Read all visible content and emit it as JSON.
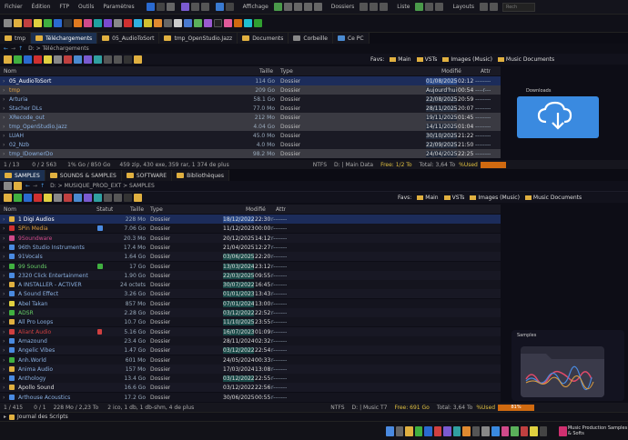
{
  "menubar": {
    "items": [
      "Fichier",
      "Édition",
      "FTP",
      "Outils",
      "Paramètres"
    ],
    "affichage": "Affichage",
    "dossiers": "Dossiers",
    "liste": "Liste",
    "layouts": "Layouts",
    "search_placeholder": "Rech"
  },
  "top_tabs": [
    "tmp",
    "Téléchargements",
    "05_AudioToSort",
    "tmp_OpenStudio.Jazz",
    "Documents",
    "Corbeille",
    "Ce PC"
  ],
  "top_address": "D: > Téléchargements",
  "top_favs": {
    "label": "Favs:",
    "items": [
      "Main",
      "VSTs",
      "Images (Music)",
      "Music Documents"
    ]
  },
  "top_headers": {
    "name": "Nom",
    "size": "Taille",
    "type": "Type",
    "modified": "Modifié",
    "attr": "Attr"
  },
  "top_rows": [
    {
      "name": "05_AudioToSort",
      "size": "114 Go",
      "type": "Dossier",
      "date": "01/08/2025",
      "time": "02:12",
      "attr": "--------"
    },
    {
      "name": "tmp",
      "size": "209 Go",
      "type": "Dossier",
      "date": "Aujourd'hui",
      "time": "00:54",
      "attr": "----r---"
    },
    {
      "name": "Arturia",
      "size": "58.1 Go",
      "type": "Dossier",
      "date": "22/08/2025",
      "time": "20:59",
      "attr": "--------"
    },
    {
      "name": "Stacher DLs",
      "size": "77.0 Mo",
      "type": "Dossier",
      "date": "28/11/2025",
      "time": "20:07",
      "attr": "--------"
    },
    {
      "name": "XRecode_out",
      "size": "212 Mo",
      "type": "Dossier",
      "date": "19/11/2025",
      "time": "01:45",
      "attr": "--------"
    },
    {
      "name": "tmp_OpenStudio.Jazz",
      "size": "4.04 Go",
      "type": "Dossier",
      "date": "14/11/2025",
      "time": "01:04",
      "attr": "--------"
    },
    {
      "name": "LUAH",
      "size": "45.0 Mo",
      "type": "Dossier",
      "date": "30/10/2025",
      "time": "21:22",
      "attr": "--------"
    },
    {
      "name": "02_Nzb",
      "size": "4.0 Mo",
      "type": "Dossier",
      "date": "22/09/2025",
      "time": "21:50",
      "attr": "--------"
    },
    {
      "name": "tmp_IDownerDo",
      "size": "98.2 Mo",
      "type": "Dossier",
      "date": "24/04/2025",
      "time": "22:25",
      "attr": "--------"
    }
  ],
  "top_preview_label": "Downloads",
  "top_status": {
    "count": "1 / 13",
    "sel": "0 / 2 563",
    "size": "1% Go / 850 Go",
    "info": "459 zip, 430 exe, 359 rar, 1 374 de plus",
    "drive": "NTFS",
    "path": "D: | Main Data",
    "free": "Free: 1/2 To",
    "total": "Total: 3,64 To",
    "used": "%Used"
  },
  "bottom_tabs": [
    "SAMPLES",
    "SOUNDS & SAMPLES",
    "SOFTWARE",
    "Bibliothèques"
  ],
  "bottom_address": "D: > MUSIQUE_PROD_EXT > SAMPLES",
  "bottom_favs": {
    "label": "Favs:",
    "items": [
      "Main",
      "VSTs",
      "Images (Music)",
      "Music Documents"
    ]
  },
  "bottom_headers": {
    "name": "Nom",
    "status": "Statut",
    "size": "Taille",
    "type": "Type",
    "modified": "Modifié",
    "attr": "Attr"
  },
  "bottom_rows": [
    {
      "name": "1 Digi Audios",
      "size": "228 Mo",
      "type": "Dossier",
      "date": "18/12/2022",
      "time": "22:30",
      "attr": "r-------"
    },
    {
      "name": "SPin Media",
      "size": "7.06 Go",
      "type": "Dossier",
      "date": "11/12/2023",
      "time": "00:00",
      "attr": "r-------"
    },
    {
      "name": "9Soundware",
      "size": "20.3 Mo",
      "type": "Dossier",
      "date": "20/12/2025",
      "time": "14:12",
      "attr": "r-------"
    },
    {
      "name": "96th Studio Instruments",
      "size": "17.4 Mo",
      "type": "Dossier",
      "date": "21/04/2025",
      "time": "12:27",
      "attr": "r-------"
    },
    {
      "name": "91Vocals",
      "size": "1.64 Go",
      "type": "Dossier",
      "date": "03/06/2025",
      "time": "22:20",
      "attr": "r-------"
    },
    {
      "name": "99 Sounds",
      "size": "17 Go",
      "type": "Dossier",
      "date": "13/03/2024",
      "time": "23:12",
      "attr": "r-------"
    },
    {
      "name": "2320 Click Entertainment",
      "size": "1.90 Go",
      "type": "Dossier",
      "date": "22/03/2025",
      "time": "09:55",
      "attr": "r-------"
    },
    {
      "name": "A INSTALLER - ACTIVER",
      "size": "24 octets",
      "type": "Dossier",
      "date": "30/07/2022",
      "time": "16:45",
      "attr": "r-------"
    },
    {
      "name": "A Sound Effect",
      "size": "3.26 Go",
      "type": "Dossier",
      "date": "01/01/2023",
      "time": "13:43",
      "attr": "r-------"
    },
    {
      "name": "Abel Takan",
      "size": "857 Mo",
      "type": "Dossier",
      "date": "07/01/2024",
      "time": "13:00",
      "attr": "r-------"
    },
    {
      "name": "ADSR",
      "size": "2.28 Go",
      "type": "Dossier",
      "date": "03/12/2022",
      "time": "22:52",
      "attr": "r-------"
    },
    {
      "name": "All Pro Loops",
      "size": "10.7 Go",
      "type": "Dossier",
      "date": "11/10/2025",
      "time": "23:55",
      "attr": "r-------"
    },
    {
      "name": "Aliant Audio",
      "size": "5.16 Go",
      "type": "Dossier",
      "date": "16/07/2023",
      "time": "01:09",
      "attr": "r-------"
    },
    {
      "name": "Amazound",
      "size": "23.4 Go",
      "type": "Dossier",
      "date": "28/11/2024",
      "time": "02:32",
      "attr": "r-------"
    },
    {
      "name": "Angelic Vibes",
      "size": "1.47 Go",
      "type": "Dossier",
      "date": "03/12/2022",
      "time": "22:54",
      "attr": "r-------"
    },
    {
      "name": "Anh.World",
      "size": "601 Mo",
      "type": "Dossier",
      "date": "24/05/2024",
      "time": "00:33",
      "attr": "r-------"
    },
    {
      "name": "Anima Audio",
      "size": "157 Mo",
      "type": "Dossier",
      "date": "17/03/2024",
      "time": "13:08",
      "attr": "r-------"
    },
    {
      "name": "Anthology",
      "size": "13.4 Go",
      "type": "Dossier",
      "date": "03/12/2022",
      "time": "22:55",
      "attr": "r-------"
    },
    {
      "name": "Apollo Sound",
      "size": "16.6 Go",
      "type": "Dossier",
      "date": "03/12/2022",
      "time": "22:56",
      "attr": "r-------"
    },
    {
      "name": "Arthouse Acoustics",
      "size": "17.2 Go",
      "type": "Dossier",
      "date": "30/06/2025",
      "time": "00:55",
      "attr": "r-------"
    }
  ],
  "bottom_preview_label": "Samples",
  "bottom_status": {
    "count": "1 / 415",
    "sel": "0 / 1",
    "size": "228 Mo / 2,23 To",
    "info": "2 ico, 1 db, 1 db-shm, 4 de plus",
    "drive": "NTFS",
    "path": "D: | Music T7",
    "free": "Free: 691 Go",
    "total": "Total: 3,64 To",
    "used": "%Used",
    "used_pct": "81%"
  },
  "script_journal": "Journal des Scripts",
  "taskbar_item": "Music Production Samples & Softs"
}
